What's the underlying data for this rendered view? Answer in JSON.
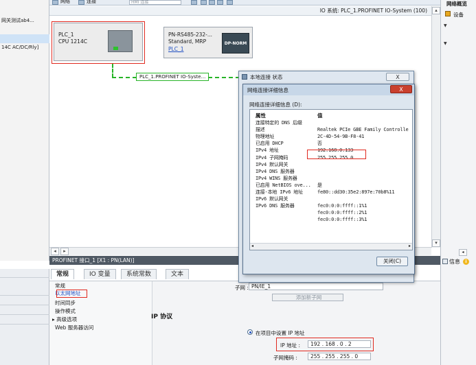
{
  "left_tree": {
    "items": [
      "网关测试ab4...",
      "",
      "",
      "",
      "14C AC/DC/Rly]",
      "",
      ""
    ]
  },
  "toolbar": {
    "network_label": "网络",
    "connections_label": "连接",
    "zoom_placeholder": "HMI 连接"
  },
  "right_panel": {
    "title": "网络概览",
    "item1": "设备",
    "info_label": "信息",
    "info_icon_label": "i"
  },
  "network_view": {
    "io_system": "IO 系统: PLC_1.PROFINET IO-System (100)",
    "plc": {
      "name": "PLC_1",
      "type": "CPU 1214C"
    },
    "device2": {
      "name": "PN-RS485-232-...",
      "type": "Standard, MRP",
      "link": "PLC_1",
      "image_label": "DP-NORM"
    },
    "network_label": "PLC_1.PROFINET IO-Syste..."
  },
  "properties": {
    "title": "PROFINET 接口_1 [X1 : PN(LAN)]",
    "tabs": [
      "常规",
      "IO 变量",
      "系统常数",
      "文本"
    ],
    "nav": [
      "常规",
      "以太网地址",
      "时间同步",
      "操作模式",
      "▸ 高级选项",
      "Web 服务器访问"
    ],
    "subnet_label": "子网 :",
    "subnet_value": "PN/IE_1",
    "add_subnet": "添加新子网",
    "ip_protocol": "IP 协议",
    "set_in_project": "在项目中设置 IP 地址",
    "ip_label": "IP 地址 :",
    "ip_value": "192 . 168 . 0 . 2",
    "mask_label": "子网掩码 :",
    "mask_value": "255 . 255 . 255 . 0"
  },
  "status_dialog": {
    "title": "本地连接 状态",
    "close": "X"
  },
  "detail_dialog": {
    "title": "网络连接详细信息",
    "close": "X",
    "label": "网络连接详细信息 (D):",
    "col_property": "属性",
    "col_value": "值",
    "rows": [
      {
        "prop": "连接特定的 DNS 后缀",
        "value": ""
      },
      {
        "prop": "描述",
        "value": "Realtek PCIe GBE Family Controlle"
      },
      {
        "prop": "物理地址",
        "value": "2C-4D-54-9B-F8-41"
      },
      {
        "prop": "已启用 DHCP",
        "value": "否"
      },
      {
        "prop": "IPv4 地址",
        "value": "192.168.0.133"
      },
      {
        "prop": "IPv4 子网掩码",
        "value": "255.255.255.0"
      },
      {
        "prop": "IPv4 默认网关",
        "value": ""
      },
      {
        "prop": "IPv4 DNS 服务器",
        "value": ""
      },
      {
        "prop": "IPv4 WINS 服务器",
        "value": ""
      },
      {
        "prop": "已启用 NetBIOS ove...",
        "value": "是"
      },
      {
        "prop": "连接-本地 IPv6 地址",
        "value": "fe80::dd30:35e2:897e:70b8%11"
      },
      {
        "prop": "IPv6 默认网关",
        "value": ""
      },
      {
        "prop": "IPv6 DNS 服务器",
        "value": "fec0:0:0:ffff::1%1"
      },
      {
        "prop": "",
        "value": "fec0:0:0:ffff::2%1"
      },
      {
        "prop": "",
        "value": "fec0:0:0:ffff::3%1"
      }
    ],
    "close_button": "关闭(C)"
  },
  "colors": {
    "highlight": "#e0281e",
    "network": "#27b327",
    "prop_title_bg": "#4f5964"
  }
}
